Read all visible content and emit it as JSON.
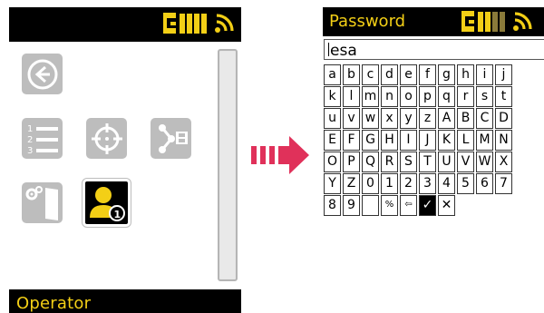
{
  "left_screen": {
    "bottom_label": "Operator",
    "active_badge": "1",
    "list_numbers": [
      "1",
      "2",
      "3"
    ],
    "icons": {
      "top_left": "battery-ruler-icon",
      "top_right": "wireless-signal-icon"
    },
    "tiles": [
      {
        "name": "back-icon"
      },
      {
        "name": "numbered-list-icon"
      },
      {
        "name": "crosshair-target-icon"
      },
      {
        "name": "save-to-file-icon"
      },
      {
        "name": "settings-door-icon"
      },
      {
        "name": "operator-icon"
      }
    ]
  },
  "right_screen": {
    "title": "Password",
    "input_value": "esa",
    "keyboard_rows": [
      [
        "a",
        "b",
        "c",
        "d",
        "e",
        "f",
        "g",
        "h",
        "i",
        "j"
      ],
      [
        "k",
        "l",
        "m",
        "n",
        "o",
        "p",
        "q",
        "r",
        "s",
        "t"
      ],
      [
        "u",
        "v",
        "w",
        "x",
        "y",
        "z",
        "A",
        "B",
        "C",
        "D"
      ],
      [
        "E",
        "F",
        "G",
        "H",
        "I",
        "J",
        "K",
        "L",
        "M",
        "N"
      ],
      [
        "O",
        "P",
        "Q",
        "R",
        "S",
        "T",
        "U",
        "V",
        "W",
        "X"
      ],
      [
        "Y",
        "Z",
        "0",
        "1",
        "2",
        "3",
        "4",
        "5",
        "6",
        "7"
      ],
      [
        "8",
        "9",
        " ",
        "%",
        "⇦",
        "✓",
        "✕"
      ]
    ]
  },
  "colors": {
    "accent": "#f3cf16",
    "arrow": "#e0315a",
    "tile_gray": "#bdbdbd",
    "bar_black": "#000000"
  }
}
